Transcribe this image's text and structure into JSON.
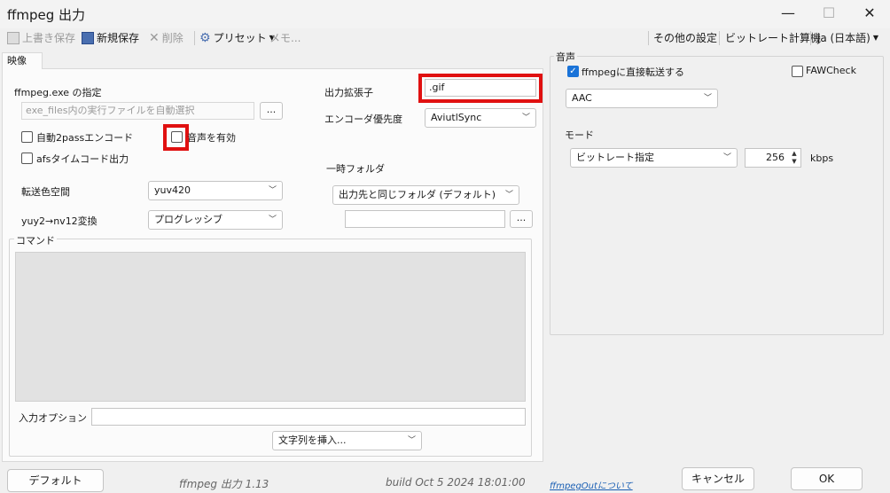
{
  "window": {
    "title": "ffmpeg 出力",
    "minimize": "—",
    "maximize": "☐",
    "close": "✕"
  },
  "toolbar": {
    "overwrite_save": "上書き保存",
    "new_save": "新規保存",
    "delete": "削除",
    "preset": "プリセット",
    "memo": "メモ...",
    "other_settings": "その他の設定",
    "bitrate_calc": "ビットレート計算機",
    "language": "ja (日本語)"
  },
  "video_tab": {
    "label": "映像",
    "exe_label": "ffmpeg.exe の指定",
    "exe_placeholder": "exe_files内の実行ファイルを自動選択",
    "browse": "...",
    "auto2pass": "自動2passエンコード",
    "audio_enable": "音声を有効",
    "afs_timecode": "afsタイムコード出力",
    "output_ext_label": "出力拡張子",
    "output_ext_value": ".gif",
    "encoder_priority_label": "エンコーダ優先度",
    "encoder_priority_value": "AviutlSync",
    "temp_folder_label": "一時フォルダ",
    "temp_folder_value": "出力先と同じフォルダ (デフォルト)",
    "temp_folder_path": "",
    "colorspace_label": "転送色空間",
    "colorspace_value": "yuv420",
    "yuy2_label": "yuy2→nv12変換",
    "yuy2_value": "プログレッシブ",
    "command_group": "コマンド",
    "command_text": "",
    "input_option_label": "入力オプション",
    "input_option_value": "",
    "insert_string": "文字列を挿入..."
  },
  "audio": {
    "group": "音声",
    "direct_transfer": "ffmpegに直接転送する",
    "direct_transfer_checked": true,
    "fawcheck": "FAWCheck",
    "fawcheck_checked": false,
    "codec_value": "AAC",
    "mode_label": "モード",
    "mode_value": "ビットレート指定",
    "bitrate_value": "256",
    "bitrate_unit": "kbps"
  },
  "footer": {
    "default_button": "デフォルト",
    "app_version": "ffmpeg 出力 1.13",
    "build": "build Oct  5 2024 18:01:00",
    "about_link": "ffmpegOutについて",
    "cancel_button": "キャンセル",
    "ok_button": "OK"
  },
  "colors": {
    "checkbox_checked": "#1a73d8",
    "highlight": "#e01010"
  }
}
